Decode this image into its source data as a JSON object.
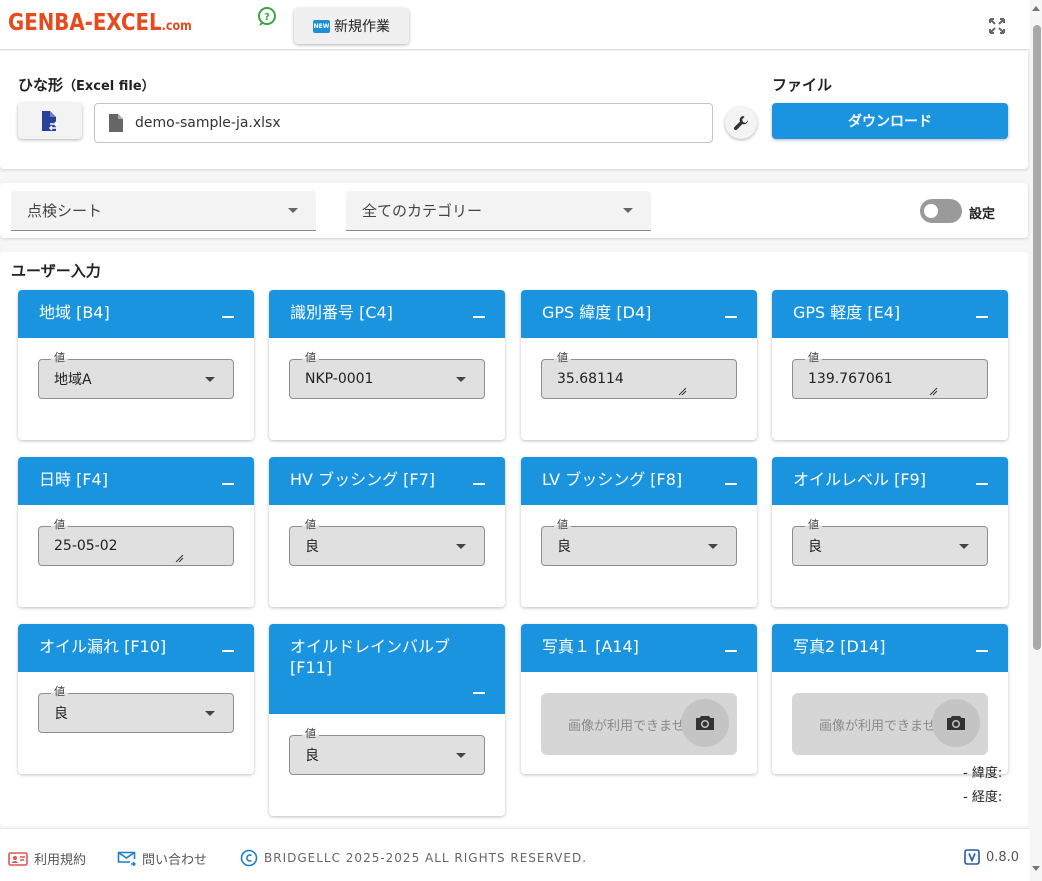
{
  "header": {
    "logo_main": "GENBA-EXCEL",
    "logo_domain": ".com",
    "new_badge": "NEW",
    "new_button_label": "新規作業"
  },
  "template": {
    "label": "ひな形",
    "label_suffix": "（Excel file）",
    "filename": "demo-sample-ja.xlsx"
  },
  "file": {
    "label": "ファイル",
    "download_label": "ダウンロード"
  },
  "filters": {
    "sheet_select": "点検シート",
    "category_select": "全てのカテゴリー",
    "settings_toggle_label": "設定",
    "settings_on": false
  },
  "section_title": "ユーザー入力",
  "cards": [
    {
      "title": "地域 [B4]",
      "field_label": "値",
      "value": "地域A",
      "kind": "select"
    },
    {
      "title": "識別番号 [C4]",
      "field_label": "値",
      "value": "NKP-0001",
      "kind": "select"
    },
    {
      "title": "GPS 緯度 [D4]",
      "field_label": "値",
      "value": "35.68114",
      "kind": "text"
    },
    {
      "title": "GPS 軽度 [E4]",
      "field_label": "値",
      "value": "139.767061",
      "kind": "text"
    },
    {
      "title": "日時 [F4]",
      "field_label": "値",
      "value": "25-05-02",
      "kind": "text"
    },
    {
      "title": "HV ブッシング [F7]",
      "field_label": "値",
      "value": "良",
      "kind": "select"
    },
    {
      "title": "LV ブッシング [F8]",
      "field_label": "値",
      "value": "良",
      "kind": "select"
    },
    {
      "title": "オイルレベル [F9]",
      "field_label": "値",
      "value": "良",
      "kind": "select"
    },
    {
      "title": "オイル漏れ [F10]",
      "field_label": "値",
      "value": "良",
      "kind": "select"
    },
    {
      "title": "オイルドレインバルブ [F11]",
      "field_label": "値",
      "value": "良",
      "kind": "select"
    },
    {
      "title": "写真１ [A14]",
      "placeholder": "画像が利用できません",
      "kind": "photo"
    },
    {
      "title": "写真2 [D14]",
      "placeholder": "画像が利用できません",
      "kind": "photo"
    }
  ],
  "geo": {
    "latitude_label": "- 緯度:",
    "longitude_label": "- 経度:"
  },
  "footer": {
    "terms": "利用規約",
    "contact": "問い合わせ",
    "copyright": "BRIDGELLC 2025-2025 ALL RIGHTS RESERVED.",
    "version": "0.8.0"
  },
  "colors": {
    "accent": "#1b94df",
    "logo": "#e8491d",
    "footer_icon_red": "#e05555"
  }
}
